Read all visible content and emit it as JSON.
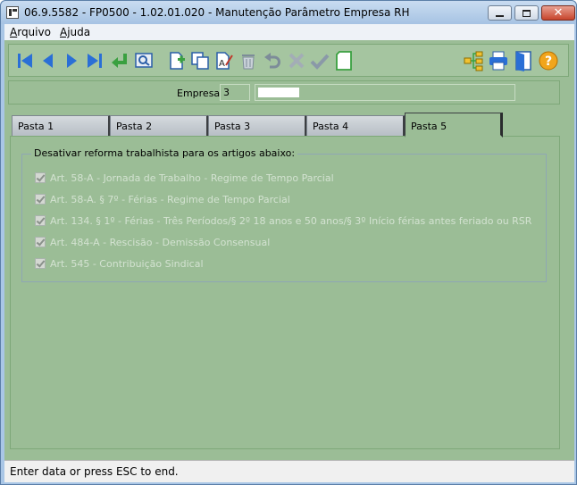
{
  "window": {
    "title": "06.9.5582 - FP0500 - 1.02.01.020 - Manutenção Parâmetro Empresa RH"
  },
  "menubar": {
    "items": [
      {
        "label_first": "A",
        "label_rest": "rquivo"
      },
      {
        "label_first": "Aj",
        "label_rest": "uda"
      }
    ]
  },
  "toolbar": {
    "icons": [
      "first-record-icon",
      "previous-record-icon",
      "next-record-icon",
      "last-record-icon",
      "goto-icon",
      "search-icon",
      "new-record-icon",
      "copy-record-icon",
      "edit-record-icon",
      "delete-record-icon",
      "undo-icon",
      "cancel-icon",
      "save-icon",
      "blank-document-icon",
      "hierarchy-icon",
      "print-icon",
      "exit-icon",
      "help-icon"
    ],
    "colors": {
      "nav": "#2a6fd6",
      "accent": "#3aa040",
      "help": "#f1a51c"
    }
  },
  "empresa": {
    "label": "Empresa:",
    "code": "3",
    "name": ""
  },
  "tabs": [
    {
      "label": "Pasta 1",
      "active": false
    },
    {
      "label": "Pasta 2",
      "active": false
    },
    {
      "label": "Pasta 3",
      "active": false
    },
    {
      "label": "Pasta 4",
      "active": false
    },
    {
      "label": "Pasta 5",
      "active": true
    }
  ],
  "group": {
    "title": "Desativar reforma trabalhista para os artigos abaixo:",
    "items": [
      {
        "label": "Art. 58-A - Jornada de Trabalho - Regime de Tempo Parcial",
        "checked": true,
        "enabled": false
      },
      {
        "label": "Art. 58-A. § 7º - Férias - Regime de Tempo Parcial",
        "checked": true,
        "enabled": false
      },
      {
        "label": "Art. 134. § 1º - Férias - Três Períodos/§ 2º 18 anos e 50 anos/§ 3º Início férias antes feriado ou RSR",
        "checked": true,
        "enabled": false
      },
      {
        "label": "Art. 484-A - Rescisão - Demissão Consensual",
        "checked": true,
        "enabled": false
      },
      {
        "label": "Art. 545 - Contribuição Sindical",
        "checked": true,
        "enabled": false
      }
    ]
  },
  "status": {
    "text": "Enter data or press ESC to end."
  }
}
